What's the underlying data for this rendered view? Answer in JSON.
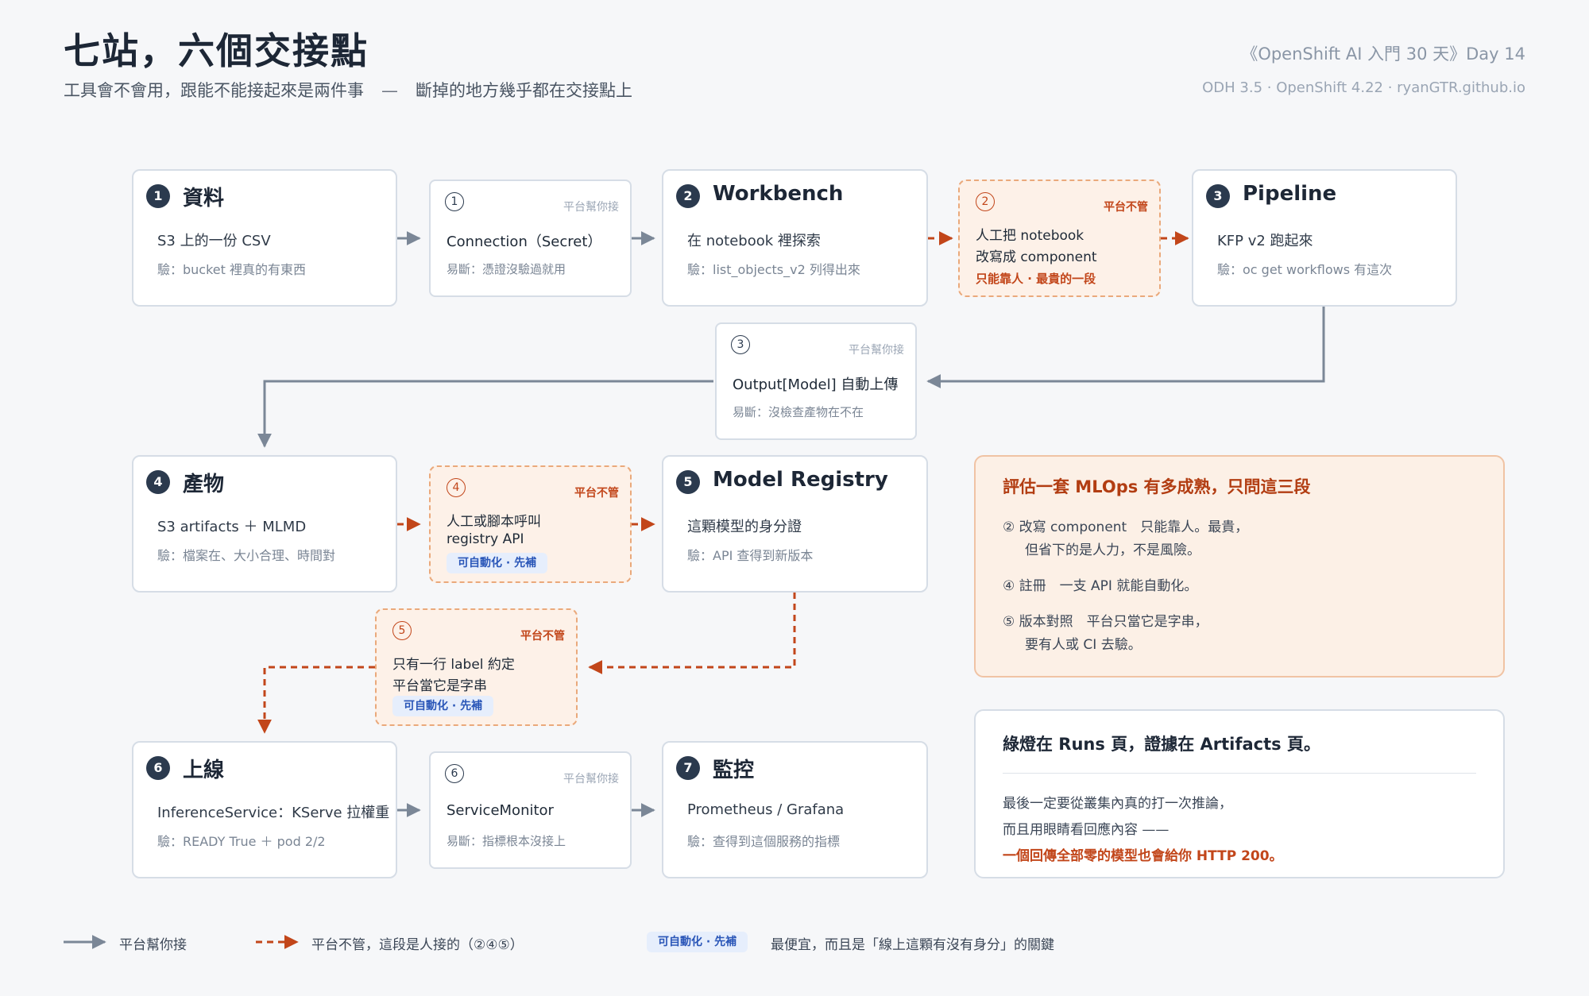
{
  "header": {
    "title": "七站，六個交接點",
    "subtitle_left": "工具會不會用，跟能不能接起來是兩件事",
    "subtitle_sep": "—",
    "subtitle_right": "斷掉的地方幾乎都在交接點上",
    "series": "《OpenShift AI 入門 30 天》Day 14",
    "meta": "ODH 3.5 · OpenShift 4.22 · ryanGTR.github.io"
  },
  "stations": [
    {
      "num": "1",
      "title": "資料",
      "line1": "S3 上的一份 CSV",
      "line2": "驗：bucket 裡真的有東西"
    },
    {
      "num": "2",
      "title": "Workbench",
      "line1": "在 notebook 裡探索",
      "line2": "驗：list_objects_v2 列得出來"
    },
    {
      "num": "3",
      "title": "Pipeline",
      "line1": "KFP v2 跑起來",
      "line2": "驗：oc get workflows 有這次"
    },
    {
      "num": "4",
      "title": "產物",
      "line1": "S3 artifacts ＋ MLMD",
      "line2": "驗：檔案在、大小合理、時間對"
    },
    {
      "num": "5",
      "title": "Model Registry",
      "line1": "這顆模型的身分證",
      "line2": "驗：API 查得到新版本"
    },
    {
      "num": "6",
      "title": "上線",
      "line1": "InferenceService：KServe 拉權重",
      "line2": "驗：READY True ＋ pod 2/2"
    },
    {
      "num": "7",
      "title": "監控",
      "line1": "Prometheus / Grafana",
      "line2": "驗：查得到這個服務的指標"
    }
  ],
  "handoffs_platform": [
    {
      "num": "1",
      "tag": "平台幫你接",
      "line1": "Connection（Secret）",
      "line2": "易斷：憑證沒驗過就用"
    },
    {
      "num": "3",
      "tag": "平台幫你接",
      "line1": "Output[Model] 自動上傳",
      "line2": "易斷：沒檢查產物在不在"
    },
    {
      "num": "6",
      "tag": "平台幫你接",
      "line1": "ServiceMonitor",
      "line2": "易斷：指標根本沒接上"
    }
  ],
  "handoffs_manual": [
    {
      "num": "2",
      "tag": "平台不管",
      "line1": "人工把 notebook",
      "line2": "改寫成 component",
      "warn": "只能靠人 · 最貴的一段"
    },
    {
      "num": "4",
      "tag": "平台不管",
      "line1": "人工或腳本呼叫",
      "line2": "registry API",
      "pill": "可自動化 · 先補"
    },
    {
      "num": "5",
      "tag": "平台不管",
      "line1": "只有一行 label 約定",
      "line2": "平台當它是字串",
      "pill": "可自動化 · 先補"
    }
  ],
  "panel_mlops": {
    "title": "評估一套 MLOps 有多成熟，只問這三段",
    "items": [
      {
        "line1": "② 改寫 component　只能靠人。最貴，",
        "line2": "但省下的是人力，不是風險。"
      },
      {
        "line1": "④ 註冊　一支 API 就能自動化。"
      },
      {
        "line1": "⑤ 版本對照　平台只當它是字串，",
        "line2": "要有人或 CI 去驗。"
      }
    ]
  },
  "panel_green": {
    "title": "綠燈在 Runs 頁，證據在 Artifacts 頁。",
    "line1": "最後一定要從叢集內真的打一次推論，",
    "line2": "而且用眼睛看回應內容 ——",
    "line3": "一個回傳全部零的模型也會給你 HTTP 200。"
  },
  "legend": {
    "platform": "平台幫你接",
    "manual": "平台不管，這段是人接的（②④⑤）",
    "pill": "可自動化 · 先補",
    "pill_desc": "最便宜，而且是「線上這顆有沒有身分」的關鍵"
  },
  "colors": {
    "platform_line": "#7b8797",
    "manual_line": "#c2461a",
    "badge": "#2b3a4e",
    "manual_fill": "#fdf1e8",
    "pill_fill": "#e6eefc",
    "pill_text": "#2a56b8"
  }
}
